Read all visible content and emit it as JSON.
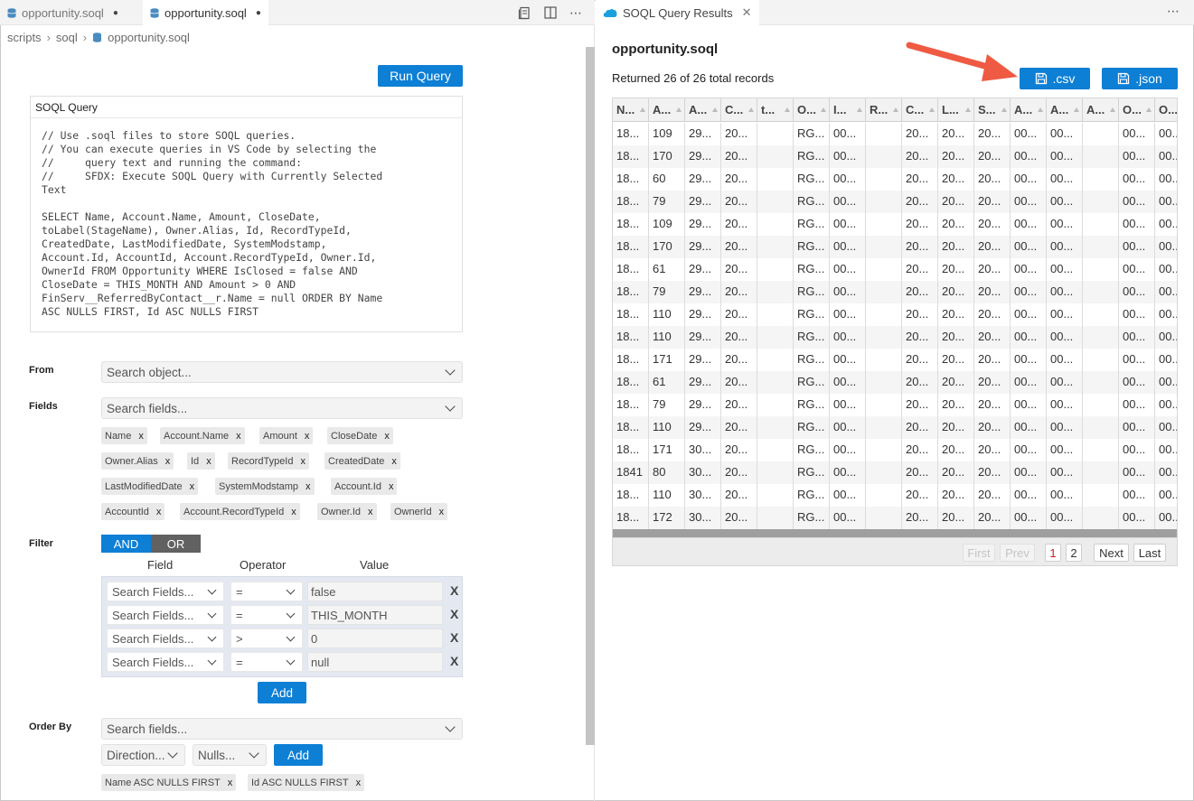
{
  "editor": {
    "tabs": [
      {
        "label": "opportunity.soql",
        "dirty": "●"
      },
      {
        "label": "opportunity.soql",
        "dirty": "●"
      }
    ],
    "breadcrumb": [
      "scripts",
      "soql",
      "opportunity.soql"
    ],
    "run_query_label": "Run Query",
    "query_header": "SOQL Query",
    "query_text": "// Use .soql files to store SOQL queries.\n// You can execute queries in VS Code by selecting the\n//     query text and running the command:\n//     SFDX: Execute SOQL Query with Currently Selected\nText\n\nSELECT Name, Account.Name, Amount, CloseDate,\ntoLabel(StageName), Owner.Alias, Id, RecordTypeId,\nCreatedDate, LastModifiedDate, SystemModstamp,\nAccount.Id, AccountId, Account.RecordTypeId, Owner.Id,\nOwnerId FROM Opportunity WHERE IsClosed = false AND\nCloseDate = THIS_MONTH AND Amount > 0 AND\nFinServ__ReferredByContact__r.Name = null ORDER BY Name\nASC NULLS FIRST, Id ASC NULLS FIRST",
    "from": {
      "label": "From",
      "placeholder": "Search object..."
    },
    "fields": {
      "label": "Fields",
      "placeholder": "Search fields...",
      "selected": [
        "Name",
        "Account.Name",
        "Amount",
        "CloseDate",
        "Owner.Alias",
        "Id",
        "RecordTypeId",
        "CreatedDate",
        "LastModifiedDate",
        "SystemModstamp",
        "Account.Id",
        "AccountId",
        "Account.RecordTypeId",
        "Owner.Id",
        "OwnerId"
      ]
    },
    "filter": {
      "label": "Filter",
      "and_label": "AND",
      "or_label": "OR",
      "col_field": "Field",
      "col_operator": "Operator",
      "col_value": "Value",
      "rows": [
        {
          "field": "Search Fields...",
          "op": "=",
          "value": "false"
        },
        {
          "field": "Search Fields...",
          "op": "=",
          "value": "THIS_MONTH"
        },
        {
          "field": "Search Fields...",
          "op": ">",
          "value": "0"
        },
        {
          "field": "Search Fields...",
          "op": "=",
          "value": "null"
        }
      ],
      "remove_label": "X",
      "add_label": "Add"
    },
    "order_by": {
      "label": "Order By",
      "placeholder": "Search fields...",
      "direction_placeholder": "Direction...",
      "nulls_placeholder": "Nulls...",
      "add_label": "Add",
      "selected": [
        "Name ASC NULLS FIRST",
        "Id ASC NULLS FIRST"
      ]
    },
    "remove_x": "x"
  },
  "results": {
    "tab_label": "SOQL Query Results",
    "title": "opportunity.soql",
    "count_text": "Returned 26 of 26 total records",
    "csv_label": ".csv",
    "json_label": ".json",
    "columns": [
      "N...",
      "A...",
      "A...",
      "C...",
      "t...",
      "O...",
      "I...",
      "R...",
      "C...",
      "L...",
      "S...",
      "A...",
      "A...",
      "A...",
      "O...",
      "O..."
    ],
    "rows": [
      [
        "18...",
        "109",
        "29...",
        "20...",
        "",
        "RG...",
        "00...",
        "",
        "20...",
        "20...",
        "20...",
        "00...",
        "00...",
        "",
        "00...",
        "00..."
      ],
      [
        "18...",
        "170",
        "29...",
        "20...",
        "",
        "RG...",
        "00...",
        "",
        "20...",
        "20...",
        "20...",
        "00...",
        "00...",
        "",
        "00...",
        "00..."
      ],
      [
        "18...",
        "60",
        "29...",
        "20...",
        "",
        "RG...",
        "00...",
        "",
        "20...",
        "20...",
        "20...",
        "00...",
        "00...",
        "",
        "00...",
        "00..."
      ],
      [
        "18...",
        "79",
        "29...",
        "20...",
        "",
        "RG...",
        "00...",
        "",
        "20...",
        "20...",
        "20...",
        "00...",
        "00...",
        "",
        "00...",
        "00..."
      ],
      [
        "18...",
        "109",
        "29...",
        "20...",
        "",
        "RG...",
        "00...",
        "",
        "20...",
        "20...",
        "20...",
        "00...",
        "00...",
        "",
        "00...",
        "00..."
      ],
      [
        "18...",
        "170",
        "29...",
        "20...",
        "",
        "RG...",
        "00...",
        "",
        "20...",
        "20...",
        "20...",
        "00...",
        "00...",
        "",
        "00...",
        "00..."
      ],
      [
        "18...",
        "61",
        "29...",
        "20...",
        "",
        "RG...",
        "00...",
        "",
        "20...",
        "20...",
        "20...",
        "00...",
        "00...",
        "",
        "00...",
        "00..."
      ],
      [
        "18...",
        "79",
        "29...",
        "20...",
        "",
        "RG...",
        "00...",
        "",
        "20...",
        "20...",
        "20...",
        "00...",
        "00...",
        "",
        "00...",
        "00..."
      ],
      [
        "18...",
        "110",
        "29...",
        "20...",
        "",
        "RG...",
        "00...",
        "",
        "20...",
        "20...",
        "20...",
        "00...",
        "00...",
        "",
        "00...",
        "00..."
      ],
      [
        "18...",
        "110",
        "29...",
        "20...",
        "",
        "RG...",
        "00...",
        "",
        "20...",
        "20...",
        "20...",
        "00...",
        "00...",
        "",
        "00...",
        "00..."
      ],
      [
        "18...",
        "171",
        "29...",
        "20...",
        "",
        "RG...",
        "00...",
        "",
        "20...",
        "20...",
        "20...",
        "00...",
        "00...",
        "",
        "00...",
        "00..."
      ],
      [
        "18...",
        "61",
        "29...",
        "20...",
        "",
        "RG...",
        "00...",
        "",
        "20...",
        "20...",
        "20...",
        "00...",
        "00...",
        "",
        "00...",
        "00..."
      ],
      [
        "18...",
        "79",
        "29...",
        "20...",
        "",
        "RG...",
        "00...",
        "",
        "20...",
        "20...",
        "20...",
        "00...",
        "00...",
        "",
        "00...",
        "00..."
      ],
      [
        "18...",
        "110",
        "29...",
        "20...",
        "",
        "RG...",
        "00...",
        "",
        "20...",
        "20...",
        "20...",
        "00...",
        "00...",
        "",
        "00...",
        "00..."
      ],
      [
        "18...",
        "171",
        "30...",
        "20...",
        "",
        "RG...",
        "00...",
        "",
        "20...",
        "20...",
        "20...",
        "00...",
        "00...",
        "",
        "00...",
        "00..."
      ],
      [
        "1841",
        "80",
        "30...",
        "20...",
        "",
        "RG...",
        "00...",
        "",
        "20...",
        "20...",
        "20...",
        "00...",
        "00...",
        "",
        "00...",
        "00..."
      ],
      [
        "18...",
        "110",
        "30...",
        "20...",
        "",
        "RG...",
        "00...",
        "",
        "20...",
        "20...",
        "20...",
        "00...",
        "00...",
        "",
        "00...",
        "00..."
      ],
      [
        "18...",
        "172",
        "30...",
        "20...",
        "",
        "RG...",
        "00...",
        "",
        "20...",
        "20...",
        "20...",
        "00...",
        "00...",
        "",
        "00...",
        "00..."
      ]
    ],
    "pager": {
      "first": "First",
      "prev": "Prev",
      "pages": [
        "1",
        "2"
      ],
      "current": "1",
      "next": "Next",
      "last": "Last"
    }
  },
  "colors": {
    "accent": "#0d7fd5",
    "arrow": "#ef5a43",
    "current_page": "#d21c1c"
  }
}
